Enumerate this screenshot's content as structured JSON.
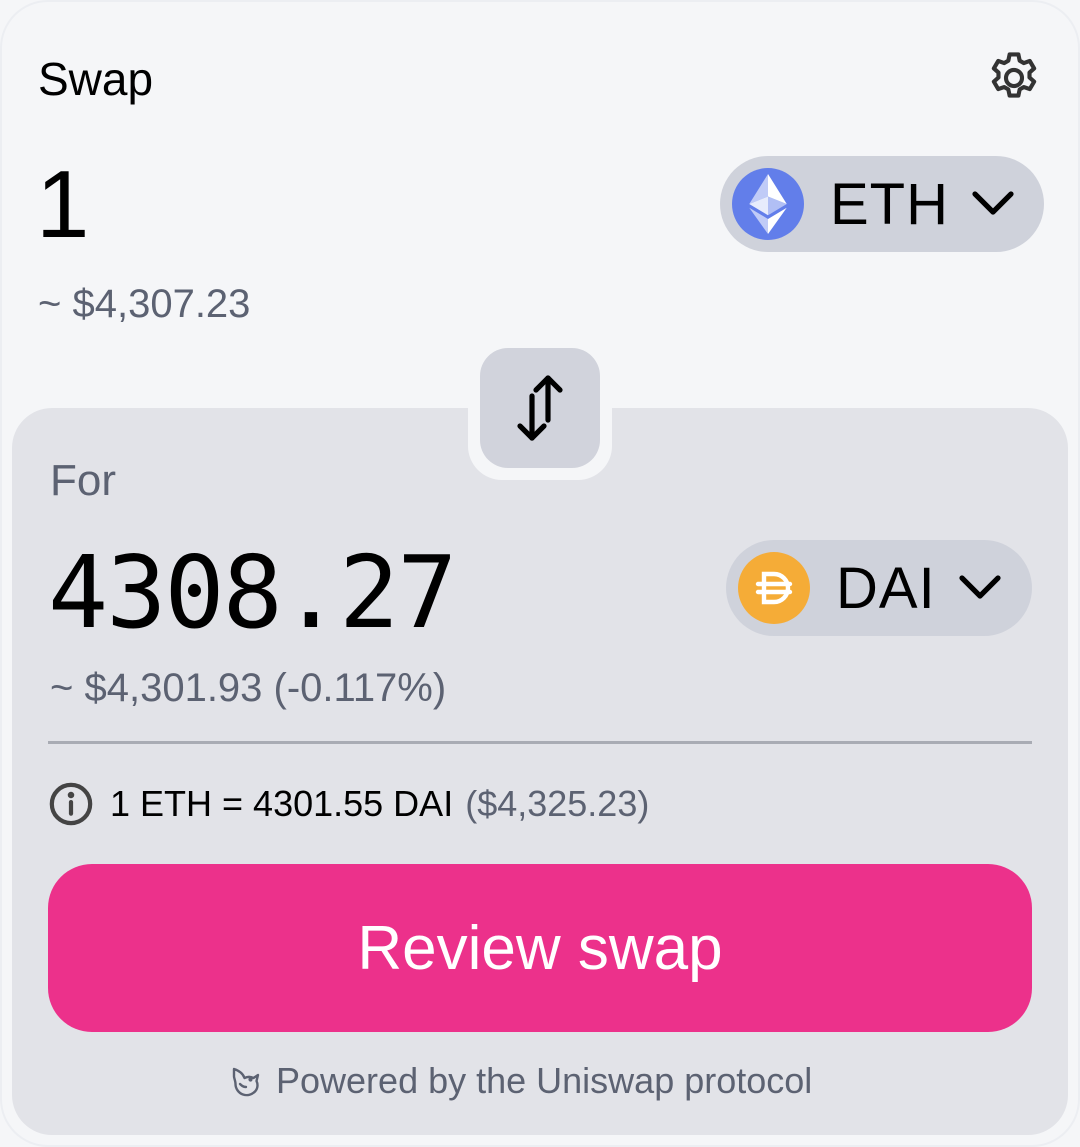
{
  "header": {
    "title": "Swap",
    "settings_icon": "gear-icon"
  },
  "sell": {
    "amount": "1",
    "usd_value": "~ $4,307.23",
    "token": {
      "symbol": "ETH",
      "icon": "ethereum-logo-icon",
      "color": "#627EEA"
    }
  },
  "swap_direction_icon": "swap-arrows-icon",
  "buy": {
    "label": "For",
    "amount": "4308.27",
    "usd_value": "~ $4,301.93 (-0.117%)",
    "token": {
      "symbol": "DAI",
      "icon": "dai-logo-icon",
      "color": "#F5AC37"
    }
  },
  "rate": {
    "text": "1 ETH = 4301.55 DAI",
    "usd": "($4,325.23)",
    "icon": "info-icon"
  },
  "review_button": {
    "label": "Review swap",
    "color": "#EC318B"
  },
  "footer": {
    "text": "Powered by the Uniswap protocol",
    "icon": "uniswap-unicorn-icon"
  }
}
